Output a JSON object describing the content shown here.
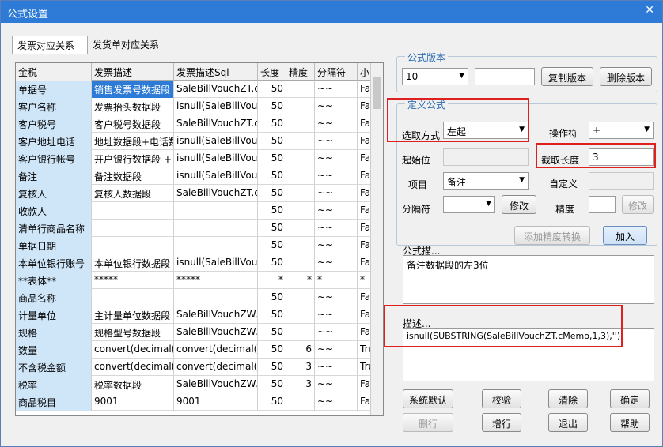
{
  "window": {
    "title": "公式设置"
  },
  "tabs": [
    "发票对应关系",
    "发货单对应关系"
  ],
  "table": {
    "headers": [
      "金税",
      "发票描述",
      "发票描述Sql",
      "长度",
      "精度",
      "分隔符",
      "小"
    ],
    "rows": [
      [
        "单据号",
        "销售发票号数据段",
        "SaleBillVouchZT.cS",
        "50",
        "",
        "~~",
        "Fa"
      ],
      [
        "客户名称",
        "发票抬头数据段",
        "isnull(SaleBillVouchZ",
        "50",
        "",
        "~~",
        "Fa"
      ],
      [
        "客户税号",
        "客户税号数据段",
        "SaleBillVouchZT.cD",
        "50",
        "",
        "~~",
        "Fa"
      ],
      [
        "客户地址电话",
        "地址数据段+电话数",
        "isnull(SaleBillVouchZ",
        "50",
        "",
        "~~",
        "Fa"
      ],
      [
        "客户银行帐号",
        "开户银行数据段 +",
        "isnull(SaleBillVouchZ",
        "50",
        "",
        "~~",
        "Fa"
      ],
      [
        "备注",
        "备注数据段",
        "isnull(SaleBillVouchZ",
        "50",
        "",
        "~~",
        "Fa"
      ],
      [
        "复核人",
        "复核人数据段",
        "SaleBillVouchZT.cD",
        "50",
        "",
        "~~",
        "Fa"
      ],
      [
        "收款人",
        "",
        "",
        "50",
        "",
        "~~",
        "Fa"
      ],
      [
        "清单行商品名称",
        "",
        "",
        "50",
        "",
        "~~",
        "Fa"
      ],
      [
        "单据日期",
        "",
        "",
        "50",
        "",
        "~~",
        "Fa"
      ],
      [
        "本单位银行账号",
        "本单位银行数据段",
        "isnull(SaleBillVouchZ",
        "50",
        "",
        "~~",
        "Fa"
      ],
      [
        "**表体**",
        "*****",
        "*****",
        "*",
        "*",
        "*",
        "*"
      ],
      [
        "商品名称",
        "",
        "",
        "50",
        "",
        "~~",
        "Fa"
      ],
      [
        "计量单位",
        "主计量单位数据段",
        "SaleBillVouchZW.cl",
        "50",
        "",
        "~~",
        "Fa"
      ],
      [
        "规格",
        "规格型号数据段",
        "SaleBillVouchZW.cl",
        "50",
        "",
        "~~",
        "Fa"
      ],
      [
        "数量",
        "convert(decimal(30,",
        "convert(decimal(30,",
        "50",
        "6",
        "~~",
        "Tru"
      ],
      [
        "不含税金额",
        "convert(decimal(30,",
        "convert(decimal(30,",
        "50",
        "3",
        "~~",
        "Tru"
      ],
      [
        "税率",
        "税率数据段",
        "SaleBillVouchZW.iT",
        "50",
        "3",
        "~~",
        "Fa"
      ],
      [
        "商品税目",
        "9001",
        "9001",
        "50",
        "",
        "~~",
        "Fa"
      ]
    ]
  },
  "version": {
    "group_title": "公式版本",
    "value": "10",
    "copy_btn": "复制版本",
    "delete_btn": "删除版本"
  },
  "define": {
    "group_title": "定义公式",
    "select_mode_label": "选取方式",
    "select_mode_value": "左起",
    "operator_label": "操作符",
    "operator_value": "+",
    "start_label": "起始位",
    "length_label": "截取长度",
    "length_value": "3",
    "item_label": "项目",
    "item_value": "备注",
    "custom_label": "自定义",
    "separator_label": "分隔符",
    "modify1": "修改",
    "precision_label": "精度",
    "modify2": "修改",
    "add_precision_btn": "添加精度转换",
    "add_btn": "加入"
  },
  "formula_desc": {
    "label": "公式描...",
    "value": "备注数据段的左3位"
  },
  "description": {
    "label": "描述...",
    "value": "isnull(SUBSTRING(SaleBillVouchZT.cMemo,1,3),'')"
  },
  "buttons": {
    "default": "系统默认",
    "check": "校验",
    "clear": "清除",
    "ok": "确定",
    "delete_row": "删行",
    "add_row": "增行",
    "exit": "退出",
    "help": "帮助"
  }
}
